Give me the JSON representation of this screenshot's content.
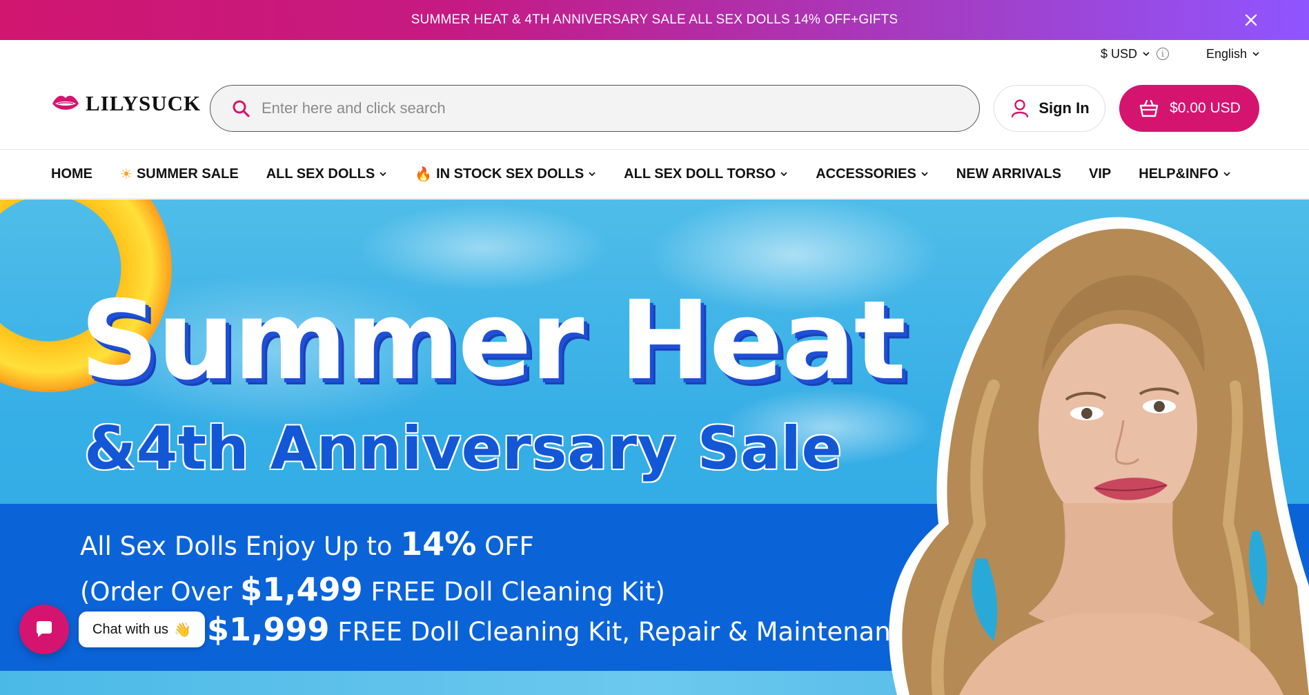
{
  "announcement": {
    "text": "SUMMER HEAT & 4TH ANNIVERSARY SALE ALL SEX DOLLS 14% OFF+GIFTS",
    "close_icon": "close-icon"
  },
  "utility": {
    "currency": "$ USD",
    "language": "English"
  },
  "header": {
    "logo_text": "LILYSUCK",
    "search_placeholder": "Enter here and click search",
    "signin_label": "Sign In",
    "cart_total": "$0.00 USD"
  },
  "nav": {
    "items": [
      {
        "label": "HOME",
        "dropdown": false,
        "icon": ""
      },
      {
        "label": "SUMMER SALE",
        "dropdown": false,
        "icon": "☀"
      },
      {
        "label": "ALL SEX DOLLS",
        "dropdown": true,
        "icon": ""
      },
      {
        "label": "IN STOCK SEX DOLLS",
        "dropdown": true,
        "icon": "🔥"
      },
      {
        "label": "ALL SEX DOLL TORSO",
        "dropdown": true,
        "icon": ""
      },
      {
        "label": "ACCESSORIES",
        "dropdown": true,
        "icon": ""
      },
      {
        "label": "NEW ARRIVALS",
        "dropdown": false,
        "icon": ""
      },
      {
        "label": "VIP",
        "dropdown": false,
        "icon": ""
      },
      {
        "label": "HELP&INFO",
        "dropdown": true,
        "icon": ""
      }
    ]
  },
  "hero": {
    "headline": "Summer Heat",
    "subhead": "&4th Anniversary Sale",
    "line1_prefix": "All Sex Dolls Enjoy Up to ",
    "line1_bold": "14%",
    "line1_suffix": " OFF",
    "line2_prefix": "(Order Over ",
    "line2_bold": "$1,499",
    "line2_suffix": " FREE Doll Cleaning Kit)",
    "line3_bold": "$1,999",
    "line3_suffix": " FREE Doll Cleaning Kit, Repair & Maintenance Kit)"
  },
  "chat": {
    "label": "Chat with us",
    "emoji": "👋"
  },
  "colors": {
    "brand": "#d5146f",
    "hero_blue": "#0b63d8",
    "headline_shadow": "#1f4fd6"
  }
}
